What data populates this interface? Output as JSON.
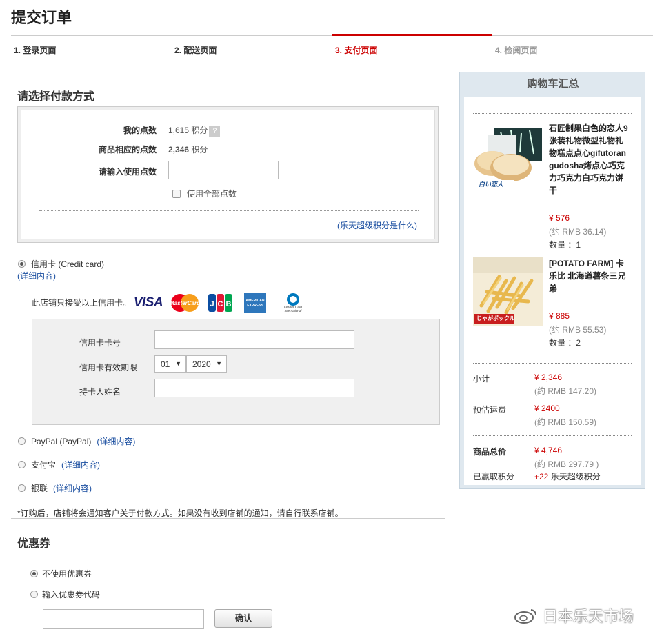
{
  "page_title": "提交订单",
  "steps": [
    {
      "label": "1. 登录页面",
      "state": "done"
    },
    {
      "label": "2. 配送页面",
      "state": "done"
    },
    {
      "label": "3. 支付页面",
      "state": "active"
    },
    {
      "label": "4. 检阅页面",
      "state": "pending"
    }
  ],
  "payment": {
    "title": "请选择付款方式",
    "points": {
      "my_points_label": "我的点数",
      "my_points_value": "1,615 积分",
      "help": "?",
      "product_points_label": "商品相应的点数",
      "product_points_value": "2,346",
      "product_points_unit": " 积分",
      "use_points_label": "请输入使用点数",
      "use_points_value": "",
      "use_all_label": "使用全部点数",
      "what_link": "(乐天超级积分是什么)"
    },
    "credit_card": {
      "label": "信用卡 (Credit card)",
      "details_link": "(详细内容)",
      "accepts_text": "此店铺只接受以上信用卡。",
      "logos": [
        "VISA",
        "MasterCard",
        "JCB",
        "AMERICAN EXPRESS",
        "Diners Club International"
      ],
      "number_label": "信用卡卡号",
      "number_value": "",
      "expiry_label": "信用卡有效期限",
      "expiry_month": "01",
      "expiry_year": "2020",
      "holder_label": "持卡人姓名",
      "holder_value": ""
    },
    "paypal": {
      "label": "PayPal (PayPal)",
      "details_link": "(详细内容)"
    },
    "alipay": {
      "label": "支付宝",
      "details_link": "(详细内容)"
    },
    "unionpay": {
      "label": "银联",
      "details_link": "(详细内容)"
    },
    "notice": "*订购后，店铺将会通知客户关于付款方式。如果没有收到店铺的通知，请自行联系店铺。"
  },
  "coupon": {
    "title": "优惠券",
    "no_coupon_label": "不使用优惠券",
    "enter_code_label": "输入优惠券代码",
    "code_value": "",
    "confirm_label": "确认"
  },
  "cart": {
    "title": "购物车汇总",
    "items": [
      {
        "name": "石匠制果白色的恋人9张装礼物微型礼物礼物糕点点心gifutorangudosha烤点心巧克力巧克力白巧克力饼干",
        "price": "¥ 576",
        "rmb": "(约 RMB 36.14)",
        "qty": "数量 ：1",
        "image_caption": "白い恋人"
      },
      {
        "name": "[POTATO FARM] 卡乐比 北海道薯条三兄弟",
        "price": "¥ 885",
        "rmb": "(约 RMB 55.53)",
        "qty": "数量 ：2",
        "image_caption": "じゃがポックル"
      }
    ],
    "subtotal_label": "小计",
    "subtotal_value": "¥ 2,346",
    "subtotal_rmb": "(约 RMB 147.20)",
    "shipping_label": "预估运费",
    "shipping_value": "¥ 2400",
    "shipping_rmb": "(约 RMB 150.59)",
    "total_label": "商品总价",
    "total_value": "¥ 4,746",
    "total_rmb": "(约 RMB 297.79 )",
    "earned_label": "已赢取积分",
    "earned_value": "+22",
    "earned_unit": " 乐天超级积分"
  },
  "watermark": "日本乐天市场",
  "colors": {
    "accent": "#cc0000",
    "link": "#1a4ea0",
    "sidebar_bg": "#dfe8ef"
  }
}
